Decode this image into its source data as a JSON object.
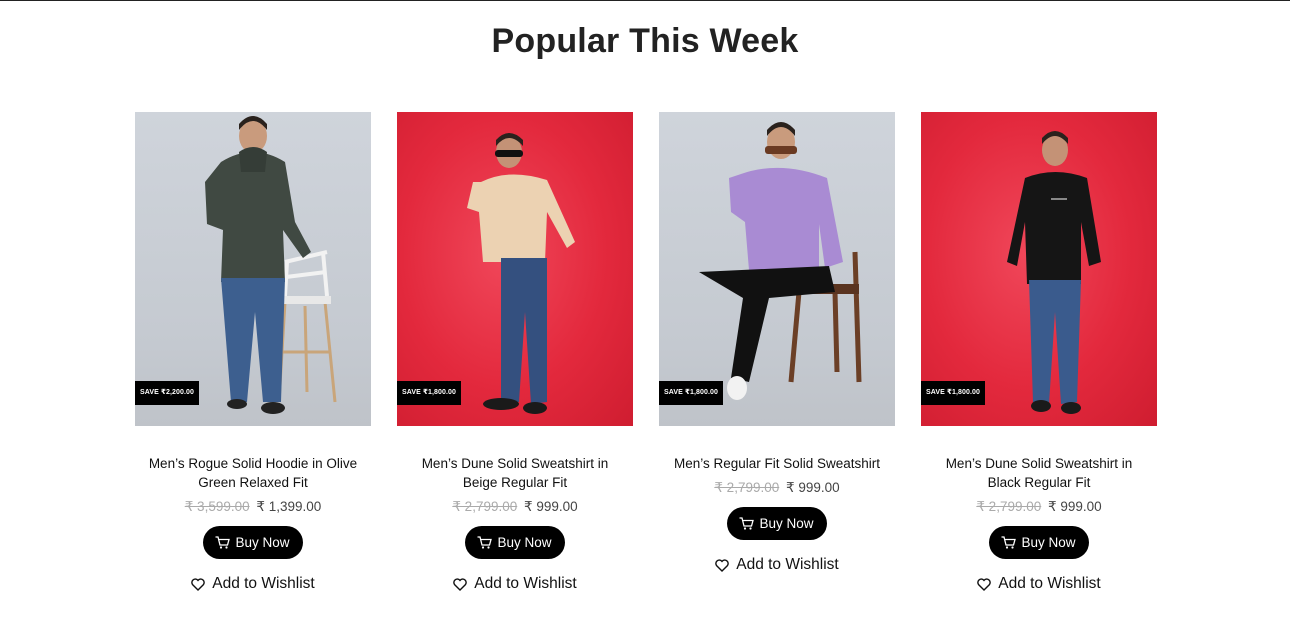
{
  "section": {
    "title": "Popular This Week"
  },
  "buy_label": "Buy Now",
  "wishlist_label": "Add to Wishlist",
  "products": [
    {
      "name": "Men’s Rogue Solid Hoodie in Olive Green Relaxed Fit",
      "old_price": "₹ 3,599.00",
      "new_price": "₹ 1,399.00",
      "badge": "SAVE ₹2,200.00",
      "background": "grey",
      "top_color": "#404942",
      "pants_color": "#3d5f8f"
    },
    {
      "name": "Men’s Dune Solid Sweatshirt in Beige Regular Fit",
      "old_price": "₹ 2,799.00",
      "new_price": "₹ 999.00",
      "badge": "SAVE ₹1,800.00",
      "background": "red",
      "top_color": "#ecd2b2",
      "pants_color": "#34507f"
    },
    {
      "name": "Men’s Regular Fit Solid Sweatshirt",
      "old_price": "₹ 2,799.00",
      "new_price": "₹ 999.00",
      "badge": "SAVE ₹1,800.00",
      "background": "grey",
      "top_color": "#a98bd3",
      "pants_color": "#111111"
    },
    {
      "name": "Men’s Dune Solid Sweatshirt in Black Regular Fit",
      "old_price": "₹ 2,799.00",
      "new_price": "₹ 999.00",
      "badge": "SAVE ₹1,800.00",
      "background": "red",
      "top_color": "#151515",
      "pants_color": "#3a5b8d"
    }
  ]
}
